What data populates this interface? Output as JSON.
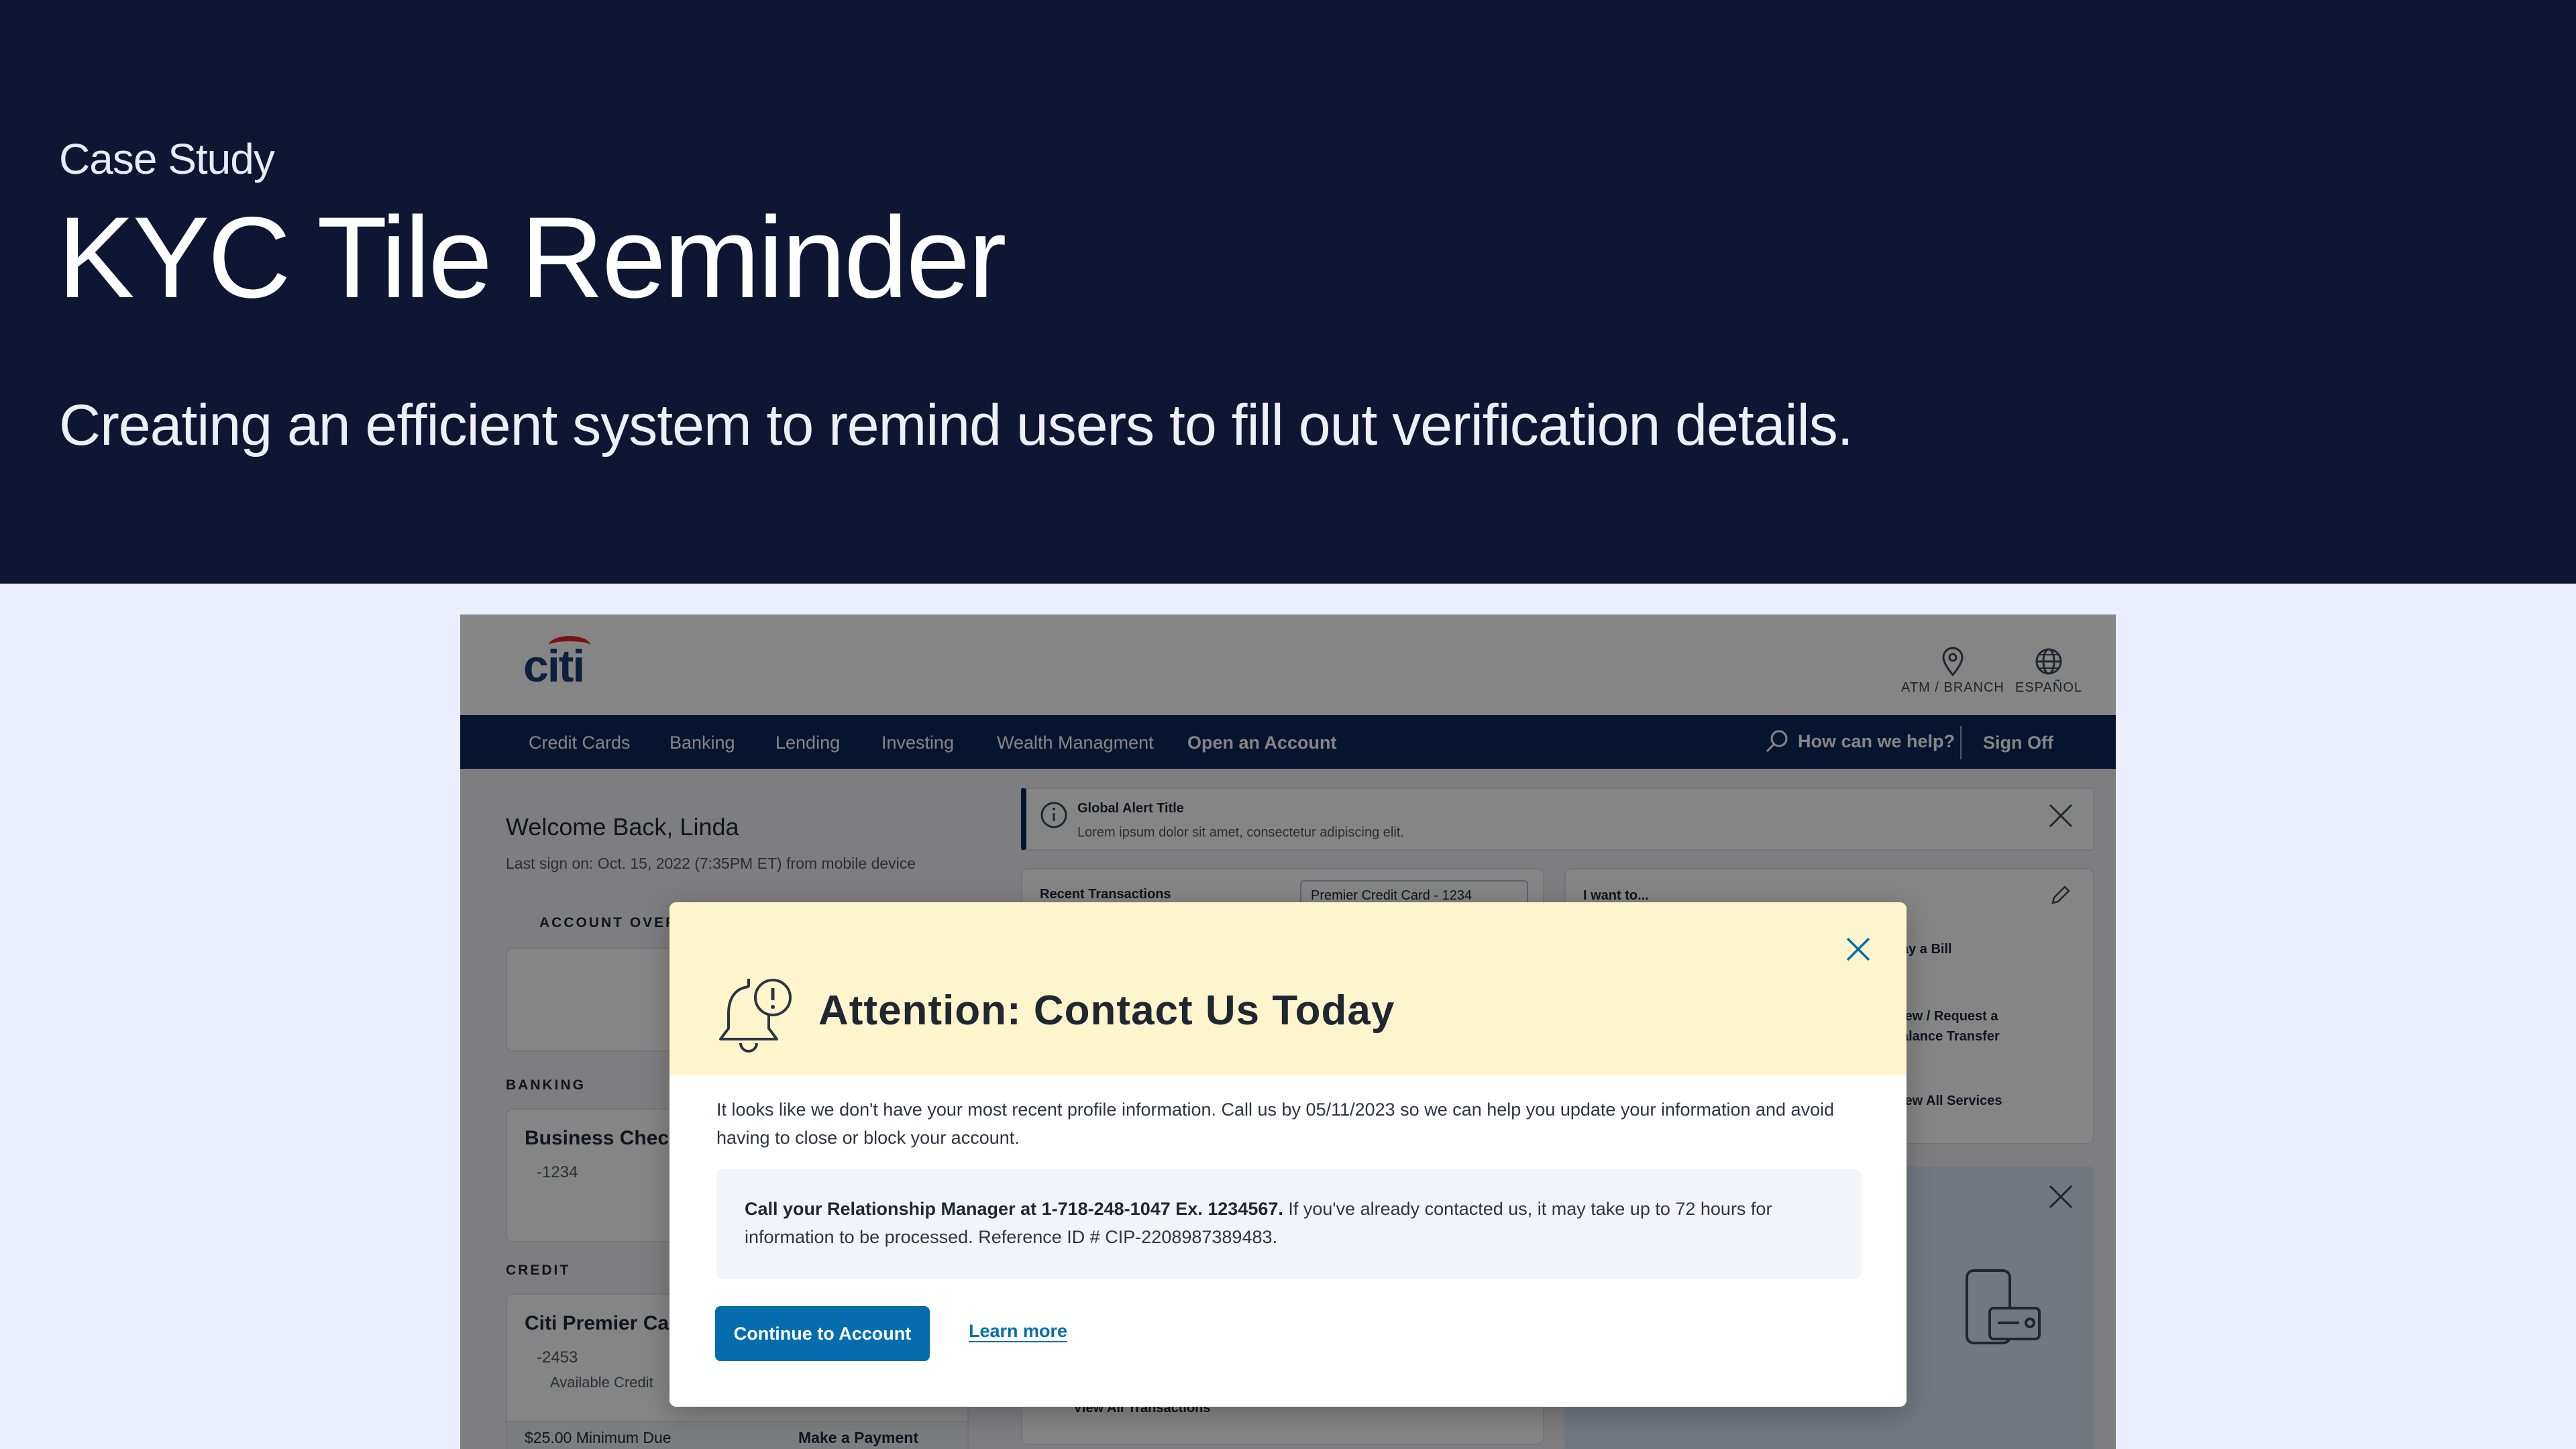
{
  "hero": {
    "eyebrow": "Case Study",
    "title": "KYC Tile Reminder",
    "subtitle": "Creating an efficient system to remind users to fill out verification details."
  },
  "app": {
    "logo": "citi",
    "utility": {
      "atm": "ATM / BRANCH",
      "language": "ESPAÑOL"
    },
    "nav": {
      "items": [
        "Credit Cards",
        "Banking",
        "Lending",
        "Investing",
        "Wealth Managment",
        "Open an Account"
      ],
      "search": "How can we help?",
      "signoff": "Sign Off"
    },
    "welcome": "Welcome Back, Linda",
    "last_sign": "Last sign on: Oct. 15, 2022 (7:35PM ET) from mobile device",
    "account_overview": "ACCOUNT OVER",
    "banking": {
      "label": "BANKING",
      "name": "Business Chec",
      "number": "-1234"
    },
    "credit": {
      "label": "CREDIT",
      "name": "Citi Premier Ca",
      "number": "-2453",
      "available": "Available Credit",
      "min_due": "$25.00 Minimum Due",
      "pay": "Make a Payment"
    },
    "alert": {
      "title": "Global Alert Title",
      "body": "Lorem ipsum dolor sit amet, consectetur adipiscing elit."
    },
    "recent": {
      "title": "Recent Transactions",
      "select": "Premier Credit Card - 1234",
      "view_all": "View All Transactions"
    },
    "iwant": {
      "title": "I want to...",
      "items": [
        "ay a Bill",
        "iew / Request a",
        "alance Transfer",
        "iew All Services"
      ]
    }
  },
  "modal": {
    "title": "Attention: Contact Us Today",
    "body": "It looks like we don't have your most recent profile information. Call us by 05/11/2023 so we can help you update your information and avoid having to close or block your account.",
    "callout_bold": "Call your Relationship Manager at 1-718-248-1047 Ex. 1234567.",
    "callout_text": " If you've already contacted us, it may take up to 72 hours for information to be processed. Reference ID # CIP-2208987389483.",
    "continue": "Continue to Account",
    "learn": "Learn more"
  },
  "colors": {
    "navy": "#0e1634",
    "citi_blue": "#056dae",
    "nav_blue": "#0b2a5c",
    "modal_header": "#fff5cc"
  }
}
